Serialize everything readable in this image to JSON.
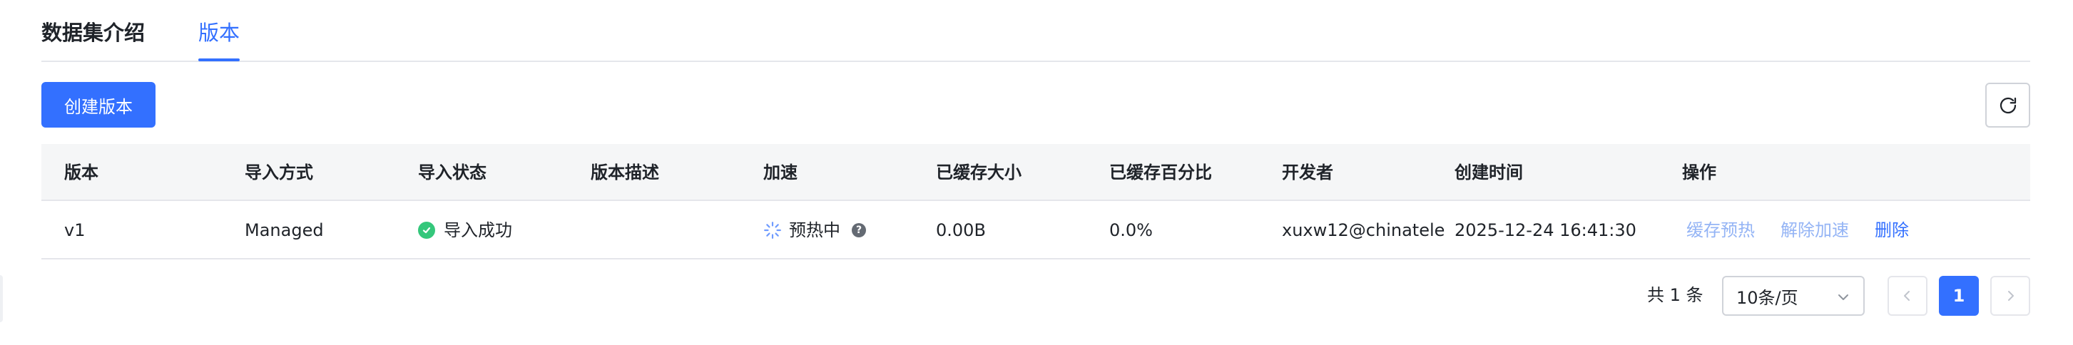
{
  "tabs": [
    {
      "label": "数据集介绍",
      "active": false
    },
    {
      "label": "版本",
      "active": true
    }
  ],
  "toolbar": {
    "create_label": "创建版本",
    "refresh_icon": "refresh-icon"
  },
  "table": {
    "headers": [
      "版本",
      "导入方式",
      "导入状态",
      "版本描述",
      "加速",
      "已缓存大小",
      "已缓存百分比",
      "开发者",
      "创建时间",
      "操作"
    ],
    "rows": [
      {
        "version": "v1",
        "import_method": "Managed",
        "import_status": "导入成功",
        "description": "",
        "acceleration": "预热中",
        "cached_size": "0.00B",
        "cached_percent": "0.0%",
        "developer": "xuxw12@chinatele",
        "created_at": "2025-12-24 16:41:30",
        "actions": [
          "缓存预热",
          "解除加速",
          "删除"
        ]
      }
    ]
  },
  "pagination": {
    "total_text": "共 1 条",
    "page_size": "10条/页",
    "current_page": "1"
  },
  "colors": {
    "accent": "#3370ff",
    "success": "#34c77b",
    "disabled_link": "#94b4f5"
  }
}
